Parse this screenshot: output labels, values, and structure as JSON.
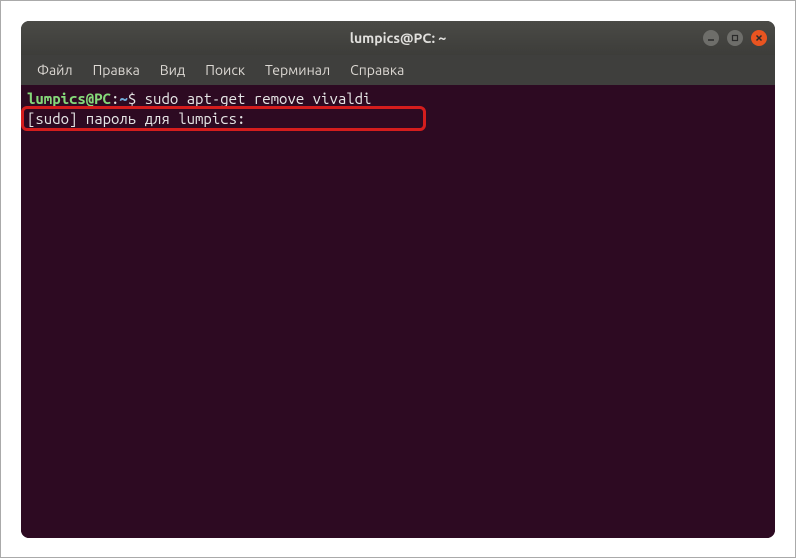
{
  "window": {
    "title": "lumpics@PC: ~"
  },
  "menubar": {
    "items": [
      {
        "label": "Файл"
      },
      {
        "label": "Правка"
      },
      {
        "label": "Вид"
      },
      {
        "label": "Поиск"
      },
      {
        "label": "Терминал"
      },
      {
        "label": "Справка"
      }
    ]
  },
  "terminal": {
    "prompt_user": "lumpics@PC",
    "prompt_sep": ":",
    "prompt_path": "~",
    "prompt_symbol": "$ ",
    "command": "sudo apt-get remove vivaldi",
    "sudo_line": "[sudo] пароль для lumpics: "
  }
}
